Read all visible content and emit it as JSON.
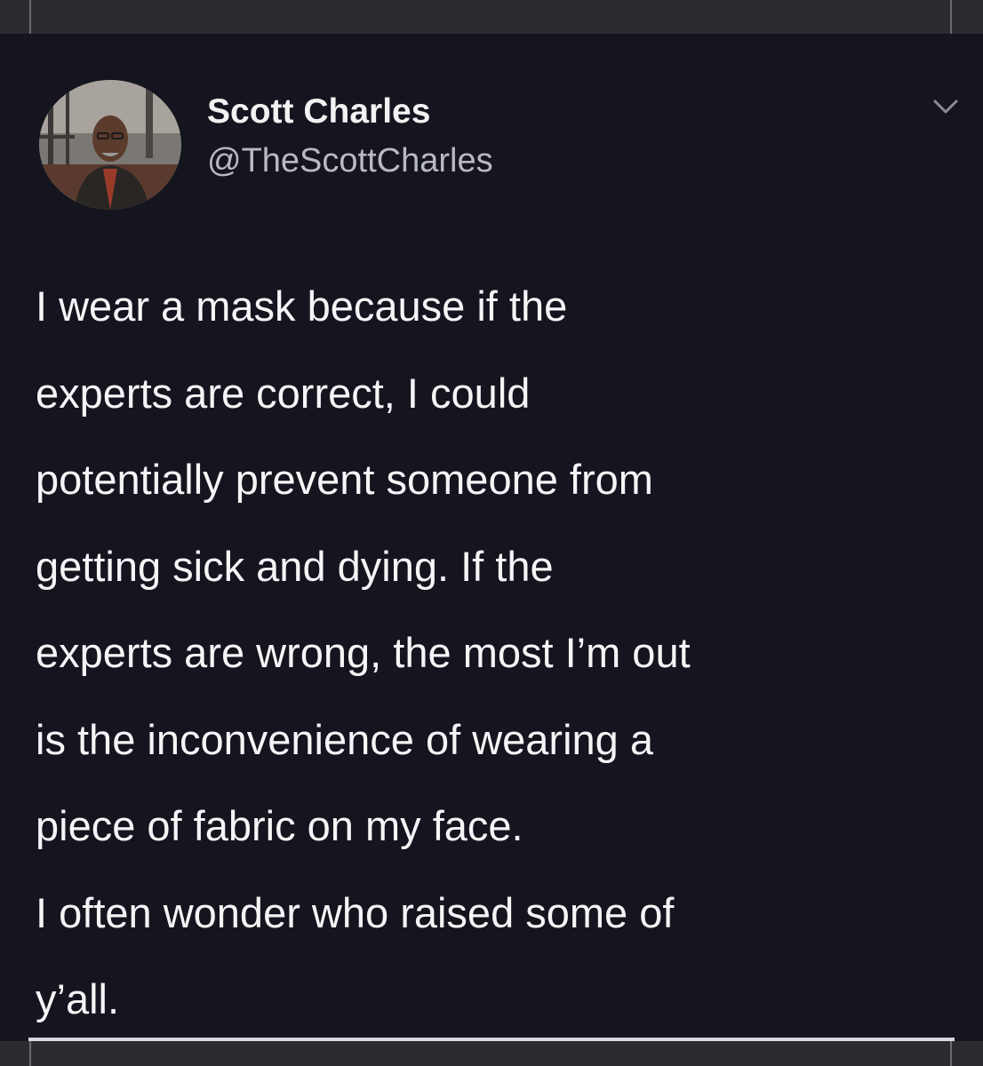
{
  "top_strip": {
    "cut_text": "ʼ    ˌ  ˌ"
  },
  "tweet": {
    "display_name": "Scott Charles",
    "handle": "@TheScottCharles",
    "text_lines": [
      "I wear a mask because if the",
      "experts are correct, I could",
      "potentially prevent someone from",
      "getting sick and dying. If the",
      "experts are wrong, the most I’m out",
      "is the inconvenience of wearing a",
      "piece of fabric on my face."
    ],
    "second_paragraph_lines": [
      "I often wonder who raised some of",
      "y’all."
    ]
  },
  "icons": {
    "avatar": "profile-photo",
    "menu": "chevron-down-icon"
  },
  "colors": {
    "background": "#14151e",
    "text": "#f5f5f7",
    "handle": "#b9bac0"
  }
}
